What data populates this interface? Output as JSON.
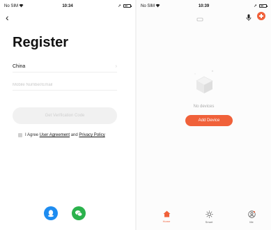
{
  "left_screen": {
    "status": {
      "carrier": "No SIM",
      "time": "10:34"
    },
    "title": "Register",
    "country": {
      "value": "China"
    },
    "account_input": {
      "placeholder": "Mobile Number/Email"
    },
    "verify_button": {
      "label": "Get Verification Code"
    },
    "agreement": {
      "prefix": "I Agree",
      "user_agreement": "User Agreement",
      "and": "and",
      "privacy_policy": "Privacy Policy"
    },
    "social": [
      "qq-icon",
      "wechat-icon"
    ]
  },
  "right_screen": {
    "status": {
      "carrier": "No SIM",
      "time": "10:39"
    },
    "no_devices": "No devices",
    "add_device_label": "Add Device",
    "tabs": [
      {
        "label": "Home",
        "icon": "home-icon",
        "active": true
      },
      {
        "label": "Smart",
        "icon": "sun-icon",
        "active": false
      },
      {
        "label": "Me",
        "icon": "user-icon",
        "active": false
      }
    ]
  },
  "colors": {
    "accent": "#f0613a",
    "qq": "#1e8cf0",
    "wechat": "#2bb24c",
    "disabled_button": "#f1f1f1"
  }
}
